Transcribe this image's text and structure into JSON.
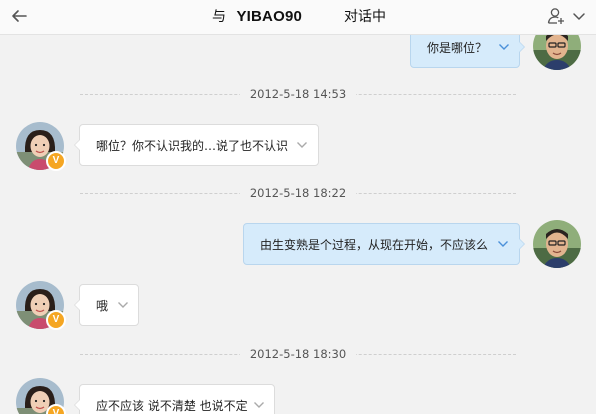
{
  "header": {
    "title_prefix": "与",
    "title_name": "YIBAO90",
    "status": "对话中",
    "icons": {
      "back": "back-arrow-icon",
      "add_user": "add-user-icon",
      "menu": "chevron-down-icon"
    }
  },
  "messages": [
    {
      "direction": "outgoing",
      "text": "你是哪位？"
    },
    {
      "timestamp": "2012-5-18 14:53"
    },
    {
      "direction": "incoming",
      "text": "哪位？你不认识我的…说了也不认识",
      "vip_badge": "V"
    },
    {
      "timestamp": "2012-5-18 18:22"
    },
    {
      "direction": "outgoing",
      "text": "由生变熟是个过程，从现在开始，不应该么"
    },
    {
      "direction": "incoming",
      "text": "哦",
      "vip_badge": "V"
    },
    {
      "timestamp": "2012-5-18 18:30"
    },
    {
      "direction": "incoming",
      "text": "应不应该 说不清楚 也说不定",
      "vip_badge": "V"
    }
  ],
  "colors": {
    "background": "#f2f2f2",
    "outgoing_bubble": "#d6ebfb",
    "incoming_bubble": "#ffffff",
    "vip_badge": "#f5a623"
  }
}
